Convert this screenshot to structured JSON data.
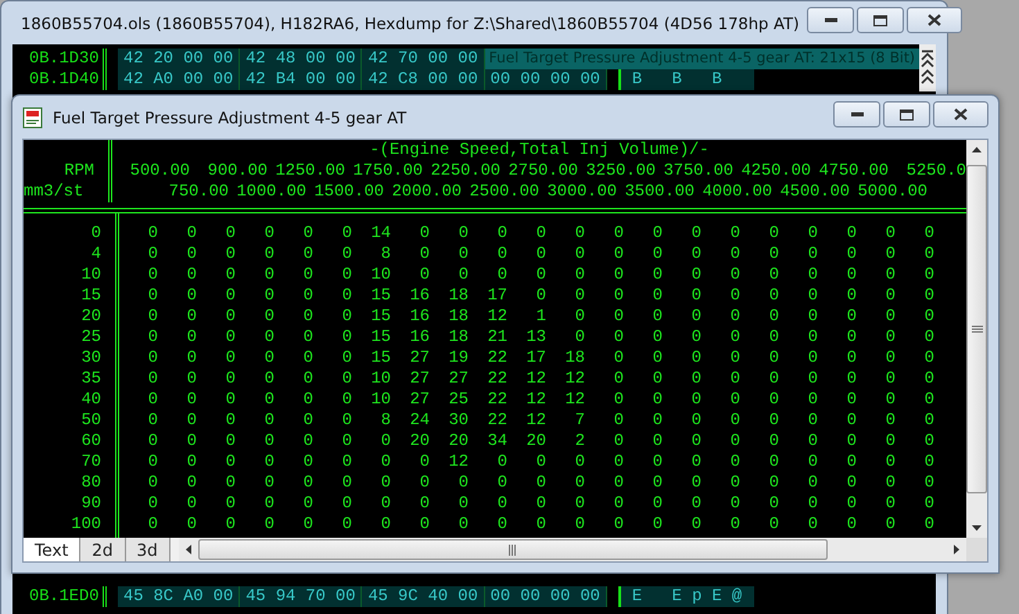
{
  "hex_window": {
    "title": "1860B55704.ols (1860B55704), H182RA6, Hexdump for Z:\\Shared\\1860B55704 (4D56 178hp AT)",
    "top_rows": [
      {
        "address": "0B.1D30",
        "groups": [
          "42 20 00 00",
          "42 48 00 00",
          "42 70 00 00"
        ],
        "annotation": "Fuel Target Pressure Adjustment 4-5 gear AT: 21x15 (8 Bit)"
      },
      {
        "address": "0B.1D40",
        "groups": [
          "42 A0 00 00",
          "42 B4 00 00",
          "42 C8 00 00",
          "00 00 00 00"
        ],
        "ascii": "B   B   B"
      }
    ],
    "bottom_rows": [
      {
        "address": "0B.1ED0",
        "groups": [
          "45 8C A0 00",
          "45 94 70 00",
          "45 9C 40 00",
          "00 00 00 00"
        ],
        "ascii": "E   E p E @"
      }
    ]
  },
  "table_window": {
    "title": "Fuel Target Pressure Adjustment 4-5 gear AT",
    "axis_title": "-(Engine Speed,Total Inj Volume)/-",
    "x_label": "RPM",
    "y_label": "mm3/st",
    "columns": [
      "500.00",
      "750.00",
      "900.00",
      "1000.00",
      "1250.00",
      "1500.00",
      "1750.00",
      "2000.00",
      "2250.00",
      "2500.00",
      "2750.00",
      "3000.00",
      "3250.00",
      "3500.00",
      "3750.00",
      "4000.00",
      "4250.00",
      "4500.00",
      "4750.00",
      "5000.00",
      "5250.0"
    ],
    "rows": [
      {
        "label": "0",
        "values": [
          "0",
          "0",
          "0",
          "0",
          "0",
          "0",
          "14",
          "0",
          "0",
          "0",
          "0",
          "0",
          "0",
          "0",
          "0",
          "0",
          "0",
          "0",
          "0",
          "0",
          "0"
        ]
      },
      {
        "label": "4",
        "values": [
          "0",
          "0",
          "0",
          "0",
          "0",
          "0",
          "8",
          "0",
          "0",
          "0",
          "0",
          "0",
          "0",
          "0",
          "0",
          "0",
          "0",
          "0",
          "0",
          "0",
          "0"
        ]
      },
      {
        "label": "10",
        "values": [
          "0",
          "0",
          "0",
          "0",
          "0",
          "0",
          "10",
          "0",
          "0",
          "0",
          "0",
          "0",
          "0",
          "0",
          "0",
          "0",
          "0",
          "0",
          "0",
          "0",
          "0"
        ]
      },
      {
        "label": "15",
        "values": [
          "0",
          "0",
          "0",
          "0",
          "0",
          "0",
          "15",
          "16",
          "18",
          "17",
          "0",
          "0",
          "0",
          "0",
          "0",
          "0",
          "0",
          "0",
          "0",
          "0",
          "0"
        ]
      },
      {
        "label": "20",
        "values": [
          "0",
          "0",
          "0",
          "0",
          "0",
          "0",
          "15",
          "16",
          "18",
          "12",
          "1",
          "0",
          "0",
          "0",
          "0",
          "0",
          "0",
          "0",
          "0",
          "0",
          "0"
        ]
      },
      {
        "label": "25",
        "values": [
          "0",
          "0",
          "0",
          "0",
          "0",
          "0",
          "15",
          "16",
          "18",
          "21",
          "13",
          "0",
          "0",
          "0",
          "0",
          "0",
          "0",
          "0",
          "0",
          "0",
          "0"
        ]
      },
      {
        "label": "30",
        "values": [
          "0",
          "0",
          "0",
          "0",
          "0",
          "0",
          "15",
          "27",
          "19",
          "22",
          "17",
          "18",
          "0",
          "0",
          "0",
          "0",
          "0",
          "0",
          "0",
          "0",
          "0"
        ]
      },
      {
        "label": "35",
        "values": [
          "0",
          "0",
          "0",
          "0",
          "0",
          "0",
          "10",
          "27",
          "27",
          "22",
          "12",
          "12",
          "0",
          "0",
          "0",
          "0",
          "0",
          "0",
          "0",
          "0",
          "0"
        ]
      },
      {
        "label": "40",
        "values": [
          "0",
          "0",
          "0",
          "0",
          "0",
          "0",
          "10",
          "27",
          "25",
          "22",
          "12",
          "12",
          "0",
          "0",
          "0",
          "0",
          "0",
          "0",
          "0",
          "0",
          "0"
        ]
      },
      {
        "label": "50",
        "values": [
          "0",
          "0",
          "0",
          "0",
          "0",
          "0",
          "8",
          "24",
          "30",
          "22",
          "12",
          "7",
          "0",
          "0",
          "0",
          "0",
          "0",
          "0",
          "0",
          "0",
          "0"
        ]
      },
      {
        "label": "60",
        "values": [
          "0",
          "0",
          "0",
          "0",
          "0",
          "0",
          "0",
          "20",
          "20",
          "34",
          "20",
          "2",
          "0",
          "0",
          "0",
          "0",
          "0",
          "0",
          "0",
          "0",
          "0"
        ]
      },
      {
        "label": "70",
        "values": [
          "0",
          "0",
          "0",
          "0",
          "0",
          "0",
          "0",
          "0",
          "12",
          "0",
          "0",
          "0",
          "0",
          "0",
          "0",
          "0",
          "0",
          "0",
          "0",
          "0",
          "0"
        ]
      },
      {
        "label": "80",
        "values": [
          "0",
          "0",
          "0",
          "0",
          "0",
          "0",
          "0",
          "0",
          "0",
          "0",
          "0",
          "0",
          "0",
          "0",
          "0",
          "0",
          "0",
          "0",
          "0",
          "0",
          "0"
        ]
      },
      {
        "label": "90",
        "values": [
          "0",
          "0",
          "0",
          "0",
          "0",
          "0",
          "0",
          "0",
          "0",
          "0",
          "0",
          "0",
          "0",
          "0",
          "0",
          "0",
          "0",
          "0",
          "0",
          "0",
          "0"
        ]
      },
      {
        "label": "100",
        "values": [
          "0",
          "0",
          "0",
          "0",
          "0",
          "0",
          "0",
          "0",
          "0",
          "0",
          "0",
          "0",
          "0",
          "0",
          "0",
          "0",
          "0",
          "0",
          "0",
          "0",
          "0"
        ]
      }
    ],
    "tabs": [
      {
        "label": "Text",
        "selected": true
      },
      {
        "label": "2d",
        "selected": false
      },
      {
        "label": "3d",
        "selected": false
      }
    ]
  }
}
